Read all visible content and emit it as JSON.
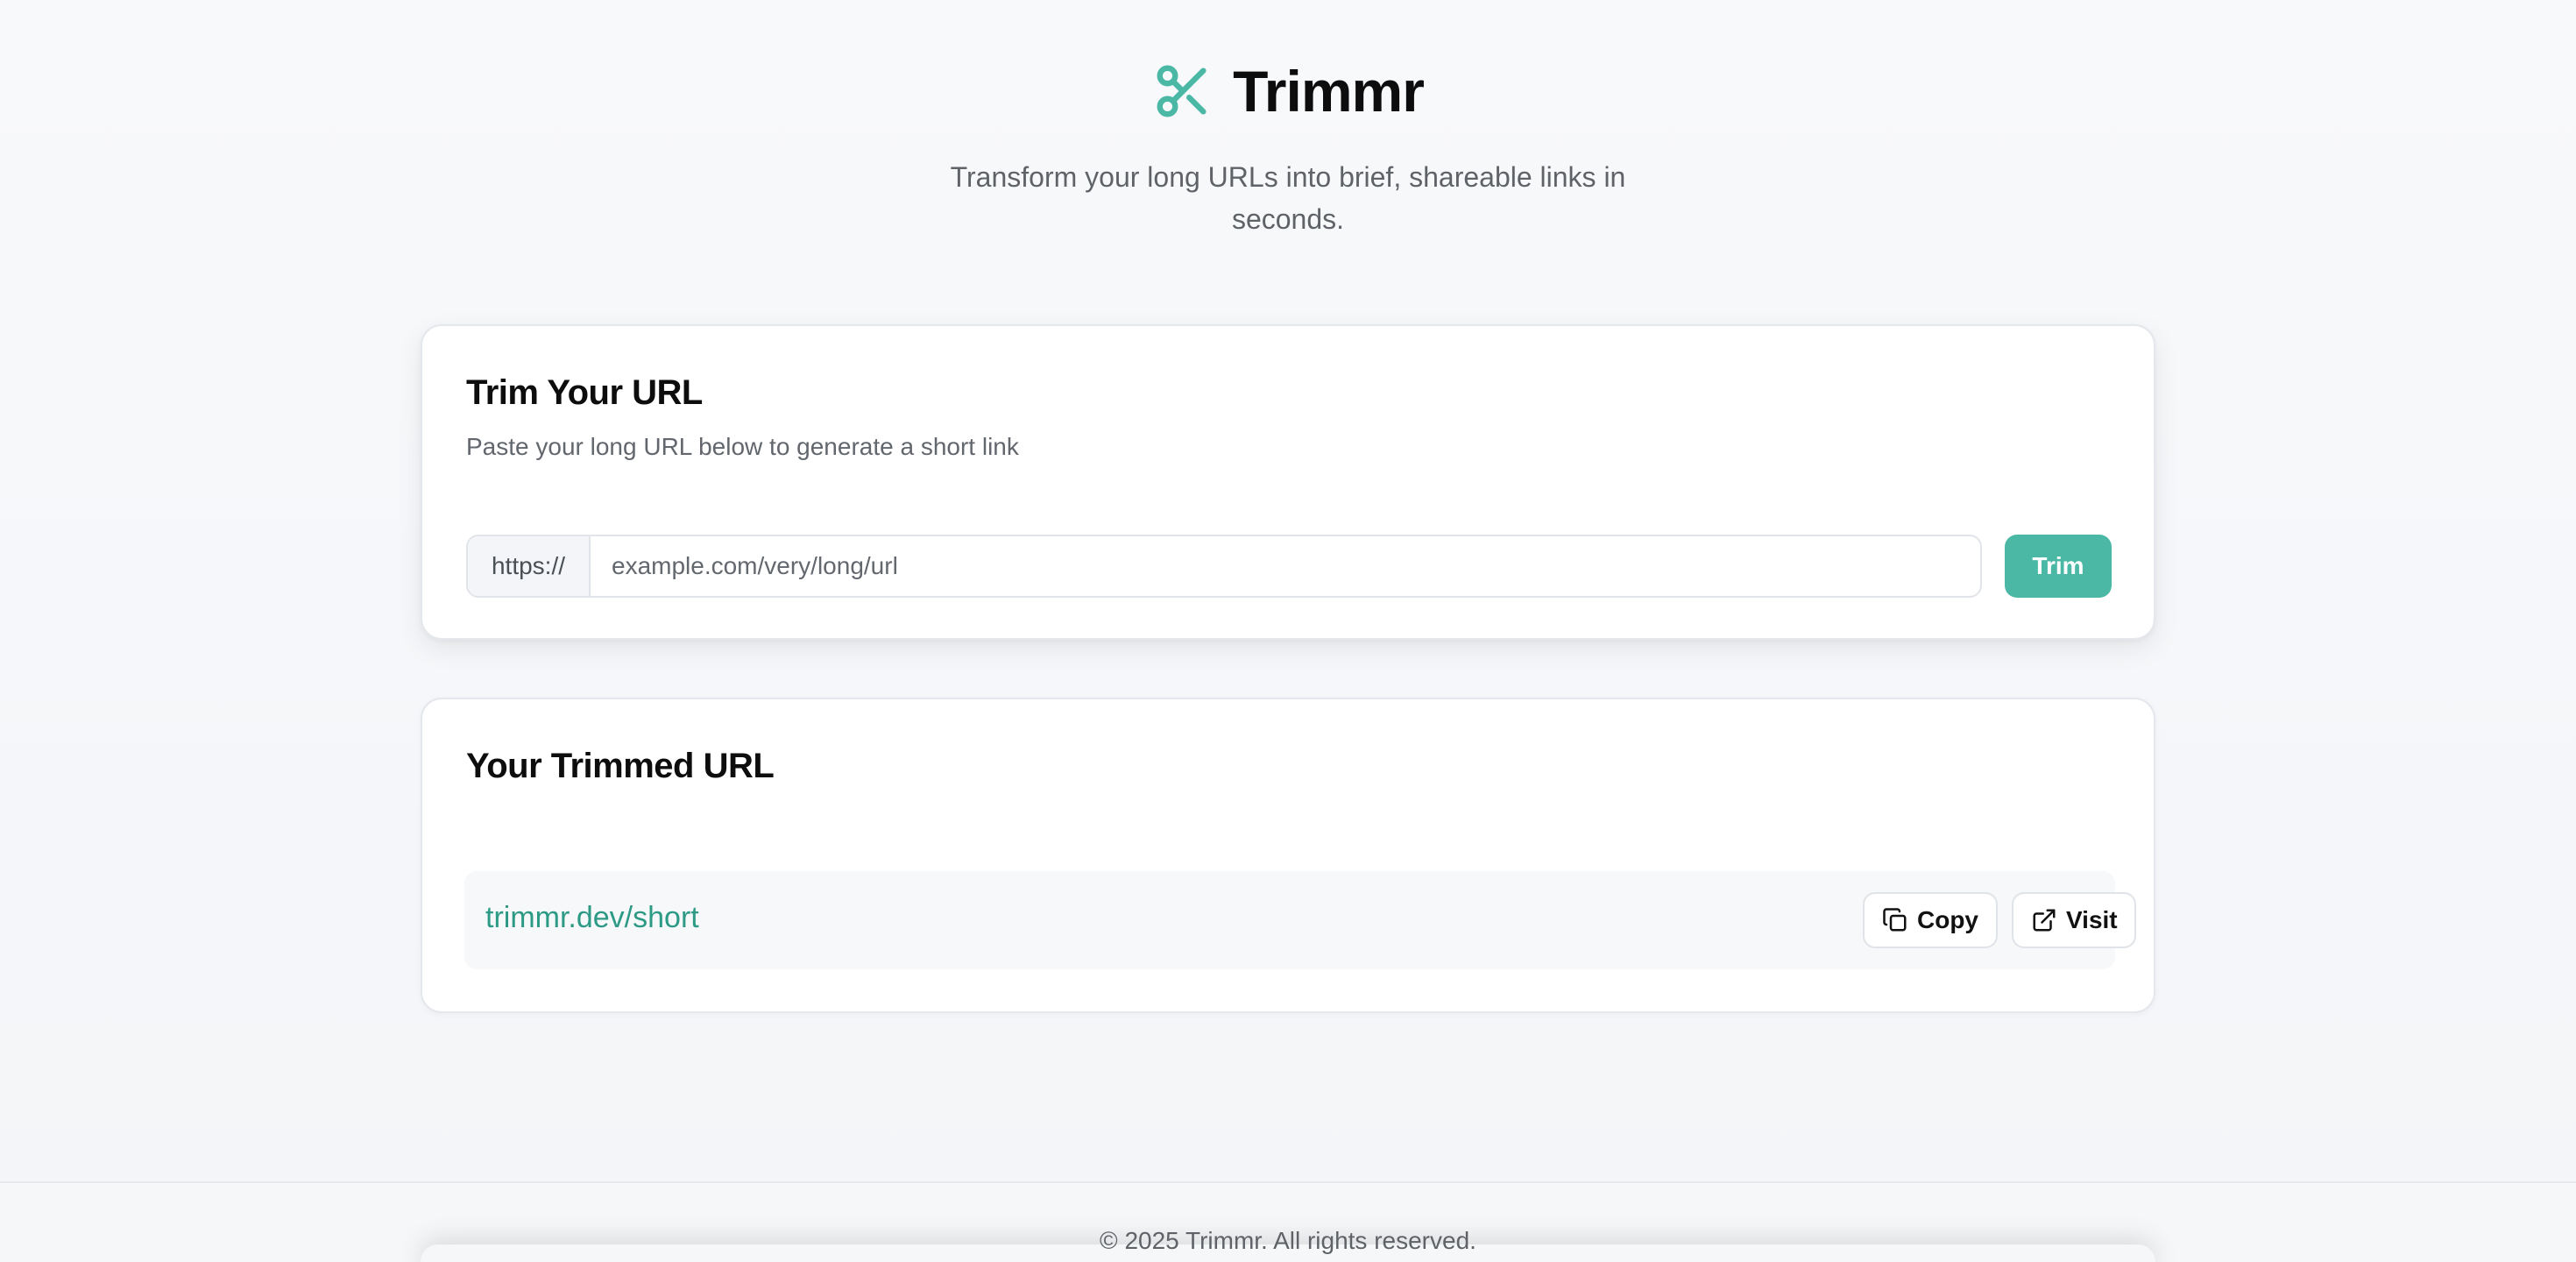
{
  "brand": {
    "title": "Trimmr",
    "icon": "scissors-icon",
    "accent_color": "#4bb8a6"
  },
  "tagline": "Transform your long URLs into brief, shareable links in seconds.",
  "trim_card": {
    "title": "Trim Your URL",
    "description": "Paste your long URL below to generate a short link",
    "prefix": "https://",
    "placeholder": "example.com/very/long/url",
    "value": "",
    "button_label": "Trim"
  },
  "result_card": {
    "title": "Your Trimmed URL",
    "short_url": "trimmr.dev/short",
    "copy_label": "Copy",
    "copy_icon": "copy-icon",
    "visit_label": "Visit",
    "visit_icon": "external-link-icon",
    "link_color": "#2d9a85"
  },
  "footer": {
    "copyright": "© 2025 Trimmr. All rights reserved."
  }
}
